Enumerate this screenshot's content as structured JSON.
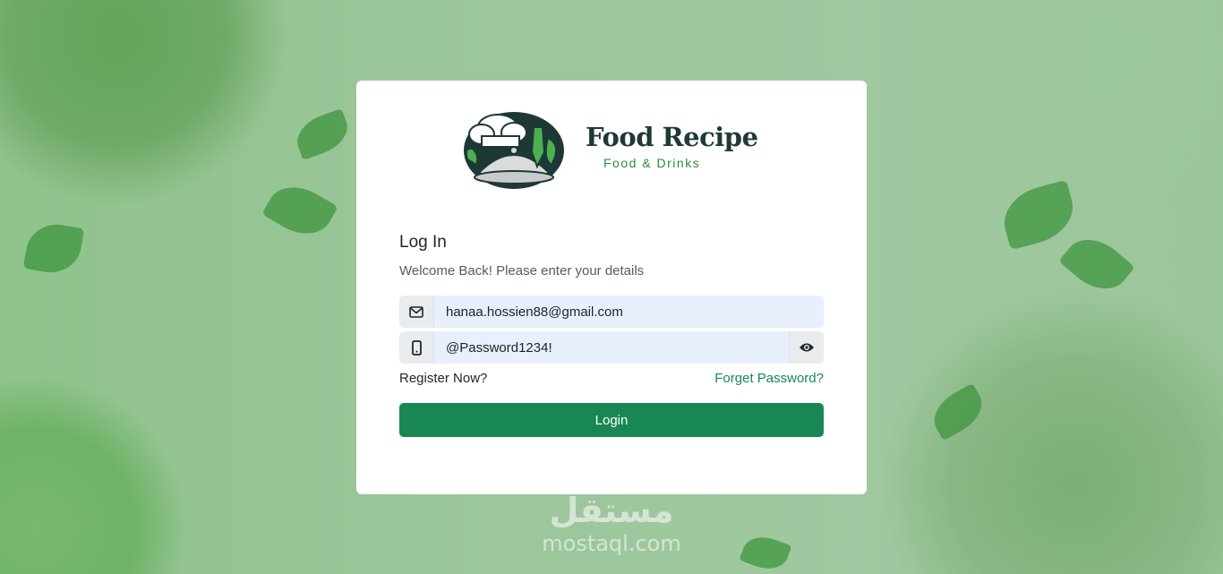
{
  "brand": {
    "title": "Food Recipe",
    "subtitle": "Food & Drinks",
    "logo_icon": "chef-cloche-logo",
    "accent": "#2d8a3e",
    "title_color": "#1f3a36"
  },
  "login": {
    "heading": "Log In",
    "welcome": "Welcome Back! Please enter your details",
    "email": {
      "value": "hanaa.hossien88@gmail.com",
      "icon": "envelope-icon"
    },
    "password": {
      "value": "@Password1234!",
      "icon": "phone-icon",
      "toggle_icon": "eye-icon"
    },
    "register_label": "Register Now?",
    "forget_label": "Forget Password?",
    "submit_label": "Login",
    "button_color": "#198754"
  },
  "watermark": {
    "arabic": "مستقل",
    "latin": "mostaql.com"
  }
}
